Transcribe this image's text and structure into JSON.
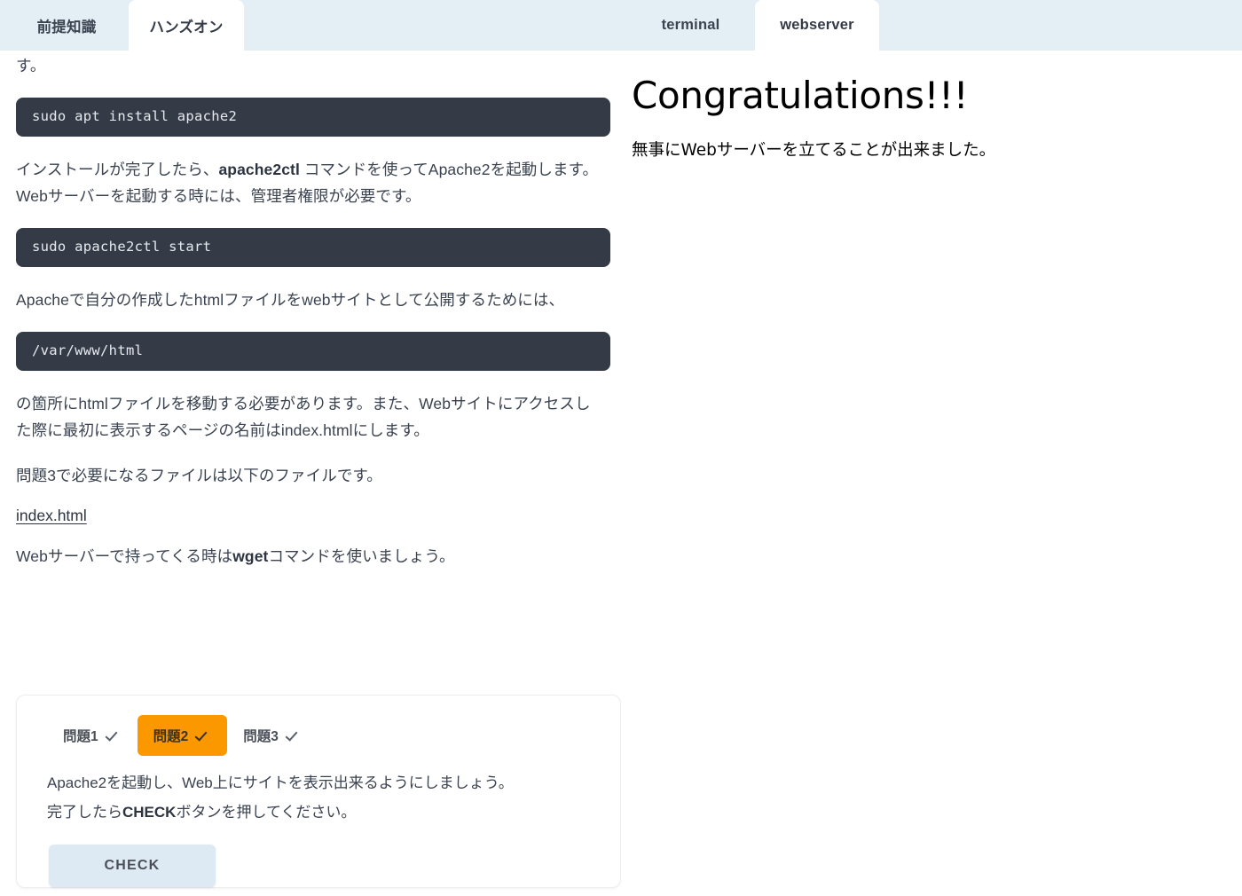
{
  "tabs": {
    "left": [
      {
        "label": "前提知識",
        "active": false
      },
      {
        "label": "ハンズオン",
        "active": true
      }
    ],
    "right": [
      {
        "label": "terminal",
        "active": false
      },
      {
        "label": "webserver",
        "active": true
      }
    ]
  },
  "lesson": {
    "para_cut_top": "す。",
    "code_install": "sudo apt install apache2",
    "para_after_install_1": "インストールが完了したら、",
    "para_after_install_bold": "apache2ctl",
    "para_after_install_2": " コマンドを使ってApache2を起動します。Webサーバーを起動する時には、管理者権限が必要です。",
    "code_start": "sudo apache2ctl start",
    "para_publish": "Apacheで自分の作成したhtmlファイルをwebサイトとして公開するためには、",
    "code_docroot": "/var/www/html",
    "para_move": "の箇所にhtmlファイルを移動する必要があります。また、Webサイトにアクセスした際に最初に表示するページの名前はindex.htmlにします。",
    "para_needed": "問題3で必要になるファイルは以下のファイルです。",
    "file_link": "index.html",
    "para_wget_1": "Webサーバーで持ってくる時は",
    "para_wget_bold": "wget",
    "para_wget_2": "コマンドを使いましょう。"
  },
  "exercise": {
    "tabs": [
      {
        "label": "問題1",
        "checked": true,
        "active": false
      },
      {
        "label": "問題2",
        "checked": true,
        "active": true
      },
      {
        "label": "問題3",
        "checked": true,
        "active": false
      }
    ],
    "instruction_line1": "Apache2を起動し、Web上にサイトを表示出来るようにしましょう。",
    "instruction_line2_pre": "完了したら",
    "instruction_line2_bold": "CHECK",
    "instruction_line2_post": "ボタンを押してください。",
    "check_button": "CHECK"
  },
  "webserver_preview": {
    "heading": "Congratulations!!!",
    "body": "無事にWebサーバーを立てることが出来ました。"
  },
  "colors": {
    "tabbar_bg": "#e3eef5",
    "tab_active_bg": "#ffffff",
    "code_bg": "#343b47",
    "code_fg": "#e6e9ee",
    "accent_orange": "#fb9800",
    "check_button_bg": "#ddeaf3",
    "body_text": "#3b4351",
    "card_border": "#ebedf0"
  }
}
